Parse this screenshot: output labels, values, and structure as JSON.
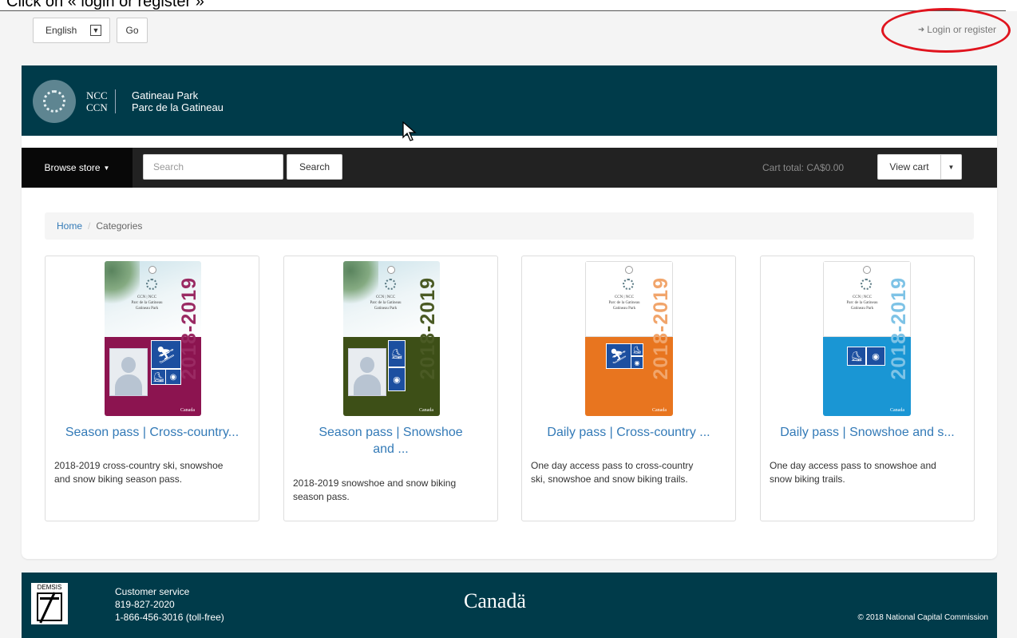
{
  "instruction": "Click on « login or register »",
  "topbar": {
    "language_value": "English",
    "go_label": "Go",
    "login_label": "Login or register"
  },
  "banner": {
    "ncc": "NCC",
    "ccn": "CCN",
    "park_en": "Gatineau Park",
    "park_fr": "Parc de la Gatineau"
  },
  "navbar": {
    "browse_label": "Browse store",
    "search_placeholder": "Search",
    "search_button": "Search",
    "cart_total_label": "Cart total:",
    "cart_total_value": "CA$0.00",
    "view_cart_label": "View cart"
  },
  "breadcrumb": {
    "home": "Home",
    "separator": "/",
    "current": "Categories"
  },
  "products": [
    {
      "title_line1": "Season pass | Cross-country...",
      "title_line2": "",
      "description_line1": "2018-2019 cross-country ski, snowshoe",
      "description_line2": "and snow biking season pass.",
      "pass_color": "#8c1450",
      "pass_years": "2018-2019",
      "pass_years_color": "#9a2a63"
    },
    {
      "title_line1": "Season pass | Snowshoe",
      "title_line2": "and ...",
      "description_line1": "2018-2019 snowshoe and snow biking",
      "description_line2": "season pass.",
      "pass_color": "#3d4f17",
      "pass_years": "2018-2019",
      "pass_years_color": "#4a5a24"
    },
    {
      "title_line1": "Daily pass | Cross-country ...",
      "title_line2": "",
      "description_line1": "One day access pass to cross-country",
      "description_line2": "ski, snowshoe and snow biking trails.",
      "pass_color": "#e8751f",
      "pass_years": "2018-2019",
      "pass_years_color": "#f1a56b"
    },
    {
      "title_line1": "Daily pass | Snowshoe and s...",
      "title_line2": "",
      "description_line1": "One day access pass to snowshoe and",
      "description_line2": "snow biking trails.",
      "pass_color": "#1a96d4",
      "pass_years": "2018-2019",
      "pass_years_color": "#7ec3e6"
    }
  ],
  "pass_card_text": {
    "ccn_ncc": "CCN | NCC",
    "park_fr": "Parc de la Gatineau",
    "park_en": "Gatineau Park",
    "canada": "Canada"
  },
  "footer": {
    "demsis": "DEMSIS",
    "customer_service": "Customer service",
    "phone": "819-827-2020",
    "tollfree": "1-866-456-3016 (toll-free)",
    "canada_wordmark": "Canadä",
    "copyright": "© 2018 National Capital Commission"
  },
  "colors": {
    "banner": "#003b4a",
    "navbar": "#222222",
    "link": "#337ab7",
    "highlight_circle": "#e0141e"
  }
}
